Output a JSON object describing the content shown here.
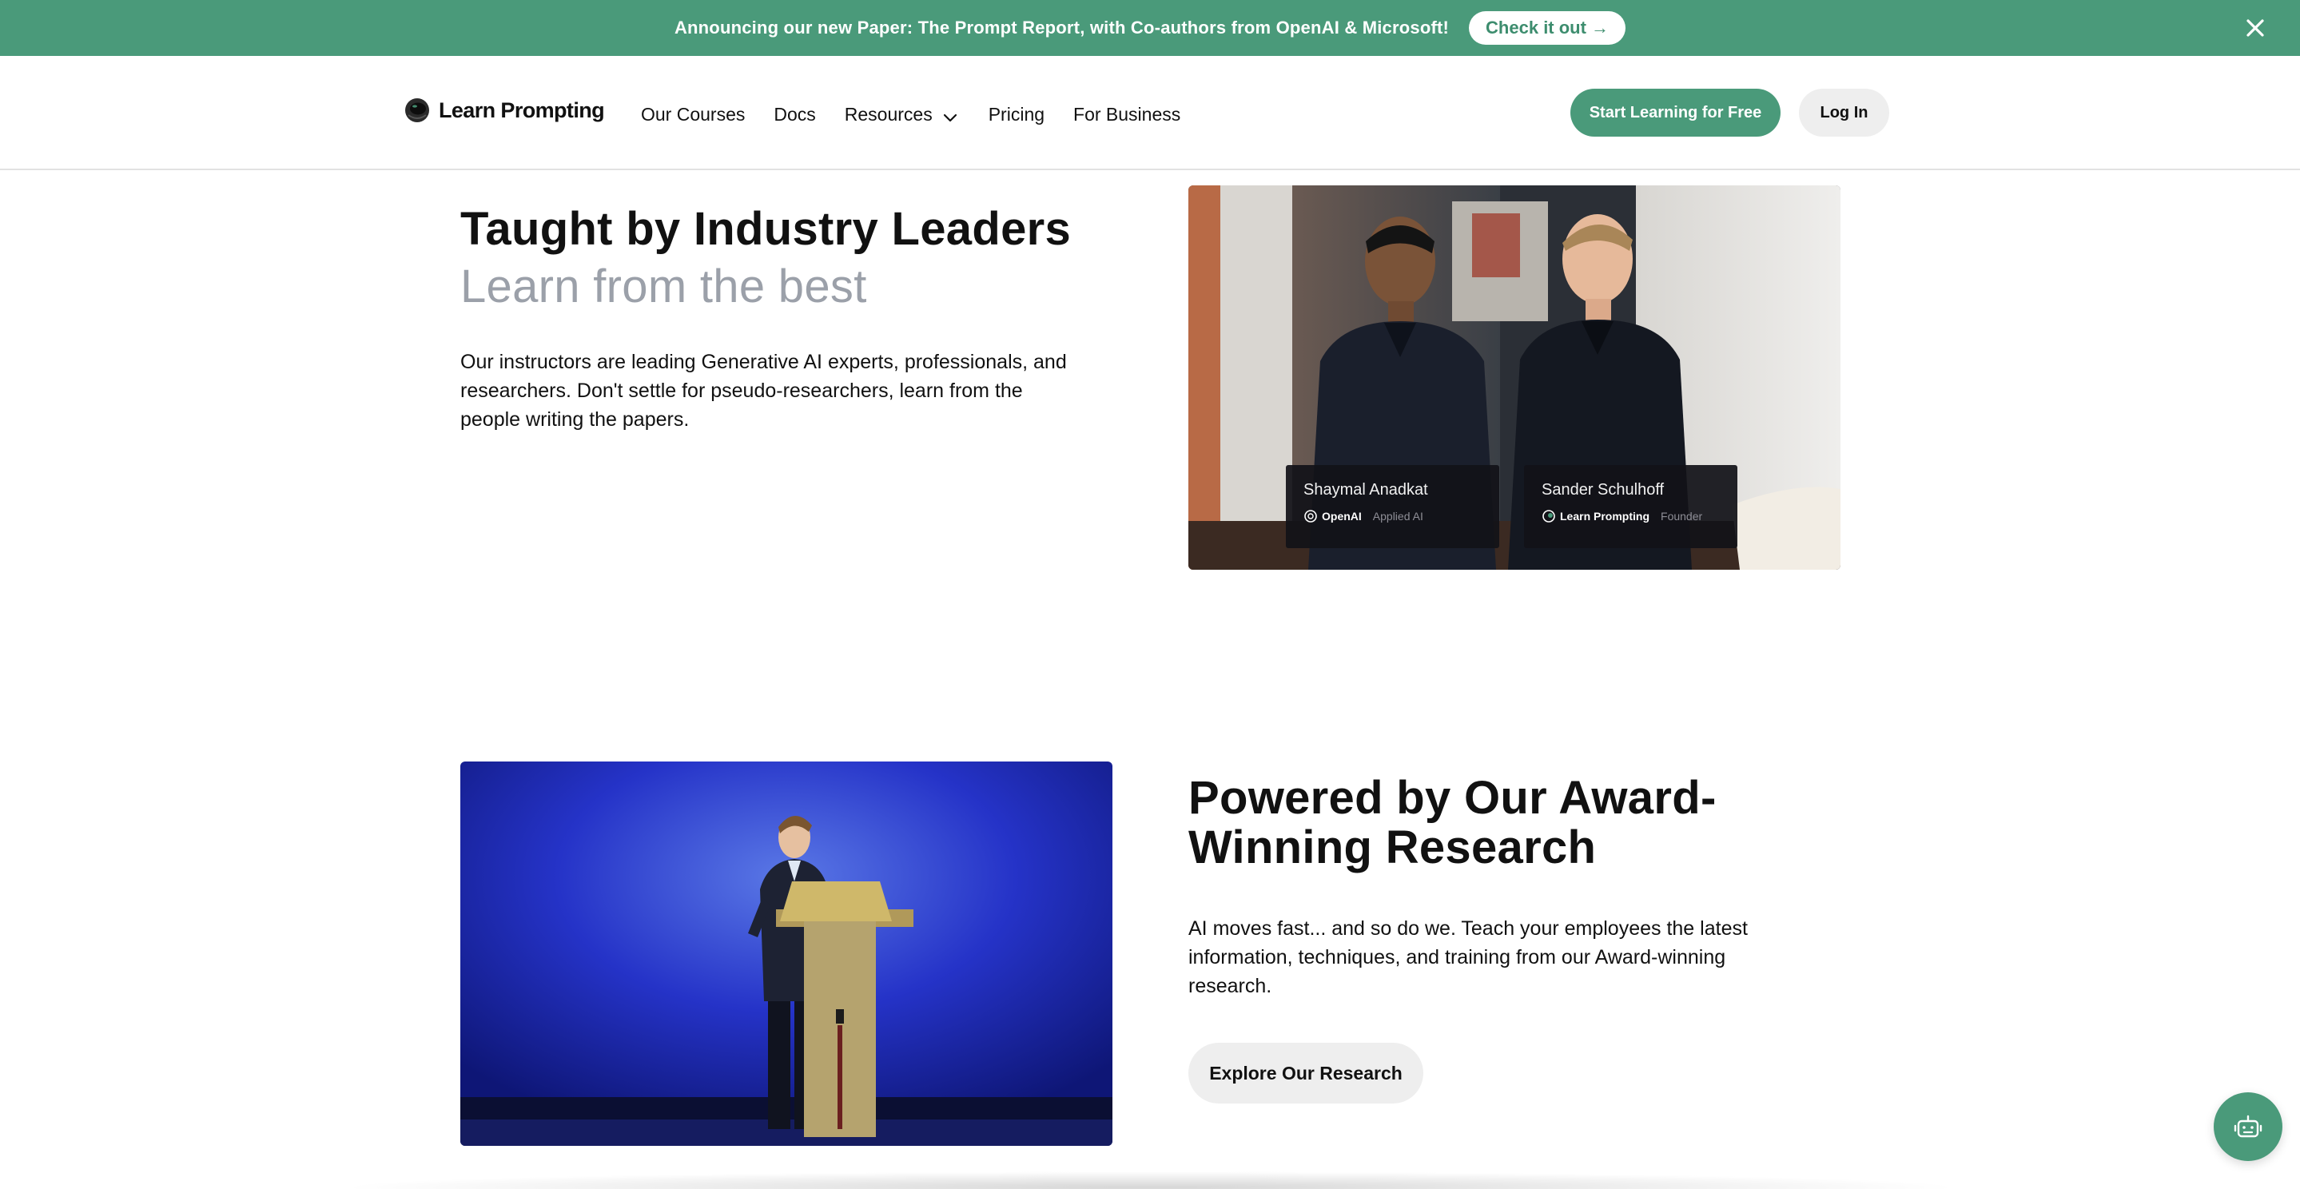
{
  "banner": {
    "text": "Announcing our new Paper: The Prompt Report, with Co-authors from OpenAI & Microsoft!",
    "cta_label": "Check it out →",
    "close_icon": "close-icon"
  },
  "header": {
    "logo_text": "Learn Prompting",
    "nav": [
      {
        "label": "Our Courses"
      },
      {
        "label": "Docs"
      },
      {
        "label": "Resources",
        "icon": "chevron-down-icon"
      },
      {
        "label": "Pricing"
      },
      {
        "label": "For Business"
      }
    ],
    "start_label": "Start Learning for Free",
    "login_label": "Log In"
  },
  "section_leaders": {
    "title": "Taught by Industry Leaders",
    "subtitle": "Learn from the best",
    "body": "Our instructors are leading Generative AI experts, professionals, and researchers. Don't settle for pseudo-researchers, learn from the people writing the papers.",
    "instructors": [
      {
        "name": "Shaymal Anadkat",
        "org": "OpenAI",
        "role": "Applied AI"
      },
      {
        "name": "Sander Schulhoff",
        "org": "Learn Prompting",
        "role": "Founder"
      }
    ]
  },
  "section_research": {
    "title": "Powered by Our Award-Winning Research",
    "body": "AI moves fast... and so do we. Teach your employees the latest information, techniques, and training from our Award-winning research.",
    "button_label": "Explore Our Research"
  },
  "colors": {
    "brand_green": "#4a9a7a",
    "subtitle_gray": "#9ba0a9",
    "button_gray": "#eeeeee"
  },
  "chat_widget_icon": "robot-icon"
}
